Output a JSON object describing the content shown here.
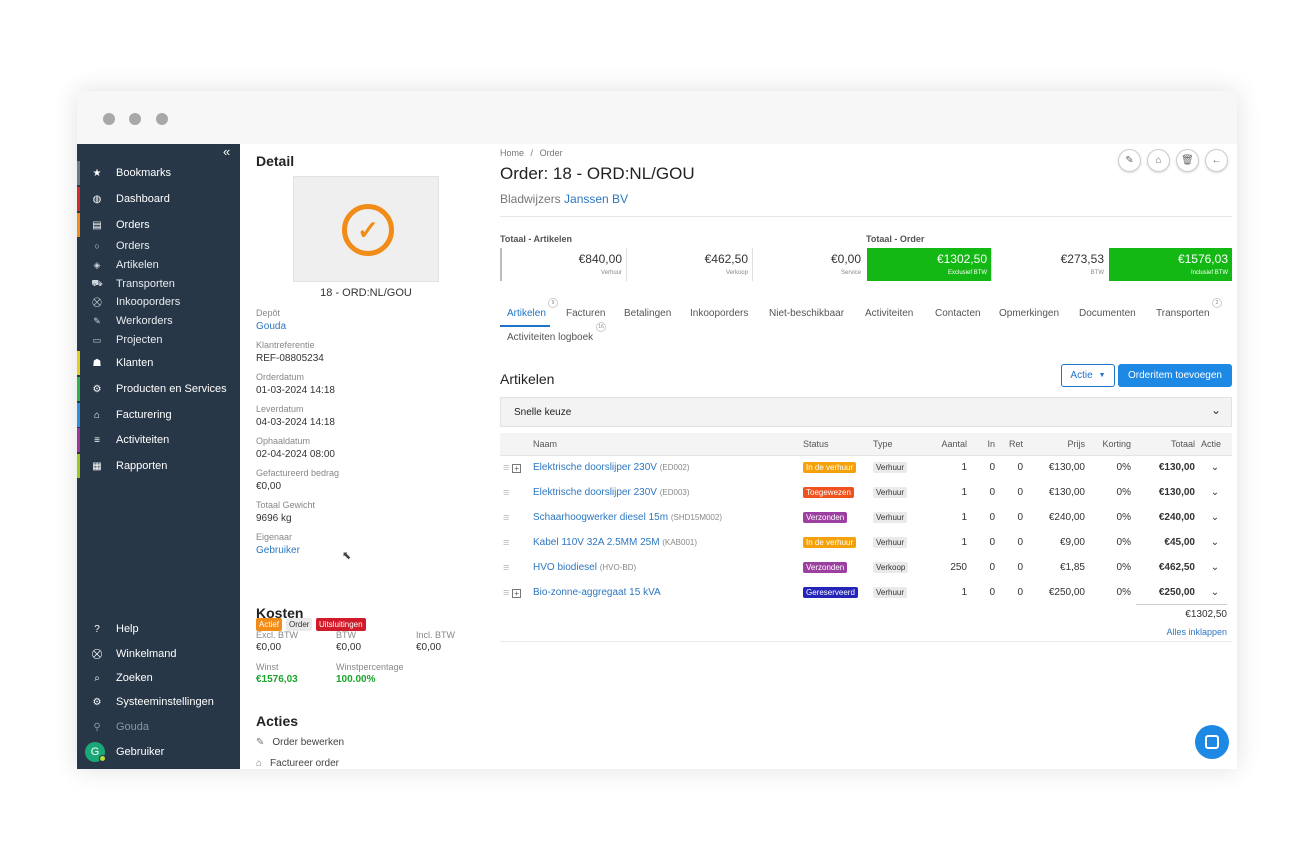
{
  "sidebar": {
    "collapse": "«",
    "main_items": [
      {
        "label": "Bookmarks",
        "icon": "★",
        "accent": "#6c7a89"
      },
      {
        "label": "Dashboard",
        "icon": "◍",
        "accent": "#d9272e"
      },
      {
        "label": "Orders",
        "icon": "▤",
        "accent": "#f28c18"
      }
    ],
    "sub_items": [
      {
        "label": "Orders",
        "icon": "○"
      },
      {
        "label": "Artikelen",
        "icon": "◈"
      },
      {
        "label": "Transporten",
        "icon": "⛟"
      },
      {
        "label": "Inkooporders",
        "icon": "⛒"
      },
      {
        "label": "Werkorders",
        "icon": "✎"
      },
      {
        "label": "Projecten",
        "icon": "▭"
      }
    ],
    "groups": [
      {
        "label": "Klanten",
        "icon": "☗",
        "accent": "#e3cf1b"
      },
      {
        "label": "Producten en Services",
        "icon": "⚙",
        "accent": "#2fb24c"
      },
      {
        "label": "Facturering",
        "icon": "⌂",
        "accent": "#2d8fe0"
      },
      {
        "label": "Activiteiten",
        "icon": "≡",
        "accent": "#a0359e"
      },
      {
        "label": "Rapporten",
        "icon": "▦",
        "accent": "#9bc81b"
      }
    ],
    "bottom": [
      {
        "label": "Help",
        "icon": "?"
      },
      {
        "label": "Winkelmand",
        "icon": "⛒"
      },
      {
        "label": "Zoeken",
        "icon": "⌕"
      },
      {
        "label": "Systeeminstellingen",
        "icon": "⚙"
      }
    ],
    "location": {
      "label": "Gouda",
      "icon": "⚲"
    },
    "user": {
      "initial": "G",
      "label": "Gebruiker"
    }
  },
  "detail": {
    "heading": "Detail",
    "order_code": "18 - ORD:NL/GOU",
    "fields": [
      {
        "label": "Depôt",
        "value": "Gouda",
        "link": true
      },
      {
        "label": "Klantreferentie",
        "value": "REF-08805234",
        "link": false
      },
      {
        "label": "Orderdatum",
        "value": "01-03-2024 14:18",
        "link": false
      },
      {
        "label": "Leverdatum",
        "value": "04-03-2024 14:18",
        "link": false
      },
      {
        "label": "Ophaaldatum",
        "value": "02-04-2024 08:00",
        "link": false
      },
      {
        "label": "Gefactureerd bedrag",
        "value": "€0,00",
        "link": false
      },
      {
        "label": "Totaal Gewicht",
        "value": "9696 kg",
        "link": false
      },
      {
        "label": "Eigenaar",
        "value": "Gebruiker",
        "link": true
      }
    ],
    "tags": [
      {
        "label": "Actief",
        "bg": "#f28c18",
        "fg": "#ffffff"
      },
      {
        "label": "Order",
        "bg": "#eaeaea",
        "fg": "#333333"
      },
      {
        "label": "Uitsluitingen",
        "bg": "#d11a2a",
        "fg": "#ffffff"
      }
    ],
    "kosten": {
      "heading": "Kosten",
      "row1": [
        {
          "label": "Excl. BTW",
          "value": "€0,00"
        },
        {
          "label": "BTW",
          "value": "€0,00"
        },
        {
          "label": "Incl. BTW",
          "value": "€0,00"
        }
      ],
      "row2": [
        {
          "label": "Winst",
          "value": "€1576,03"
        },
        {
          "label": "Winstpercentage",
          "value": "100.00%"
        }
      ]
    },
    "acties": {
      "heading": "Acties",
      "items": [
        {
          "label": "Order bewerken",
          "icon": "✎"
        },
        {
          "label": "Factureer order",
          "icon": "⌂"
        }
      ]
    }
  },
  "main": {
    "breadcrumb": {
      "home": "Home",
      "sep": "/",
      "current": "Order"
    },
    "title": "Order: 18 - ORD:NL/GOU",
    "subtitle_prefix": "Bladwijzers",
    "customer": "Janssen BV",
    "corner_buttons": [
      "✎",
      "⌂",
      "🗑",
      "←"
    ],
    "totals": {
      "artikelen_heading": "Totaal - Artikelen",
      "order_heading": "Totaal - Order",
      "cells": [
        {
          "amount": "€840,00",
          "caption": "Verhuur",
          "green": false
        },
        {
          "amount": "€462,50",
          "caption": "Verkoop",
          "green": false
        },
        {
          "amount": "€0,00",
          "caption": "Service",
          "green": false
        },
        {
          "amount": "€1302,50",
          "caption": "Exclusief BTW",
          "green": true
        },
        {
          "amount": "€273,53",
          "caption": "BTW",
          "green": false
        },
        {
          "amount": "€1576,03",
          "caption": "Inclusief BTW",
          "green": true
        }
      ]
    },
    "tabs": [
      {
        "label": "Artikelen",
        "count": "9"
      },
      {
        "label": "Facturen",
        "count": ""
      },
      {
        "label": "Betalingen",
        "count": ""
      },
      {
        "label": "Inkooporders",
        "count": ""
      },
      {
        "label": "Niet-beschikbaar",
        "count": ""
      },
      {
        "label": "Activiteiten",
        "count": ""
      },
      {
        "label": "Contacten",
        "count": ""
      },
      {
        "label": "Opmerkingen",
        "count": ""
      },
      {
        "label": "Documenten",
        "count": ""
      },
      {
        "label": "Transporten",
        "count": "2"
      }
    ],
    "tab_second_row": {
      "label": "Activiteiten logboek",
      "count": "16"
    },
    "section_title": "Artikelen",
    "actie_button": "Actie",
    "add_button": "Orderitem toevoegen",
    "snelle_keuze": "Snelle keuze",
    "table": {
      "headers": [
        "Naam",
        "Status",
        "Type",
        "Aantal",
        "In",
        "Ret",
        "Prijs",
        "Korting",
        "Totaal",
        "Actie"
      ],
      "rows": [
        {
          "expand": true,
          "name": "Elektrische doorslijper 230V",
          "code": "(ED002)",
          "status": "In de verhuur",
          "status_color": "#f5a20a",
          "type": "Verhuur",
          "aantal": "1",
          "in": "0",
          "ret": "0",
          "prijs": "€130,00",
          "korting": "0%",
          "totaal": "€130,00"
        },
        {
          "expand": false,
          "name": "Elektrische doorslijper 230V",
          "code": "(ED003)",
          "status": "Toegewezen",
          "status_color": "#f0521e",
          "type": "Verhuur",
          "aantal": "1",
          "in": "0",
          "ret": "0",
          "prijs": "€130,00",
          "korting": "0%",
          "totaal": "€130,00"
        },
        {
          "expand": false,
          "name": "Schaarhoogwerker diesel 15m",
          "code": "(SHD15M002)",
          "status": "Verzonden",
          "status_color": "#9b3fa0",
          "type": "Verhuur",
          "aantal": "1",
          "in": "0",
          "ret": "0",
          "prijs": "€240,00",
          "korting": "0%",
          "totaal": "€240,00"
        },
        {
          "expand": false,
          "name": "Kabel 110V 32A 2.5MM 25M",
          "code": "(KAB001)",
          "status": "In de verhuur",
          "status_color": "#f5a20a",
          "type": "Verhuur",
          "aantal": "1",
          "in": "0",
          "ret": "0",
          "prijs": "€9,00",
          "korting": "0%",
          "totaal": "€45,00"
        },
        {
          "expand": false,
          "name": "HVO biodiesel",
          "code": "(HVO-BD)",
          "status": "Verzonden",
          "status_color": "#9b3fa0",
          "type": "Verkoop",
          "aantal": "250",
          "in": "0",
          "ret": "0",
          "prijs": "€1,85",
          "korting": "0%",
          "totaal": "€462,50"
        },
        {
          "expand": true,
          "name": "Bio-zonne-aggregaat 15 kVA",
          "code": "",
          "status": "Gereserveerd",
          "status_color": "#2424b8",
          "type": "Verhuur",
          "aantal": "1",
          "in": "0",
          "ret": "0",
          "prijs": "€250,00",
          "korting": "0%",
          "totaal": "€250,00"
        }
      ],
      "sum": "€1302,50",
      "collapse_all": "Alles inklappen"
    }
  }
}
